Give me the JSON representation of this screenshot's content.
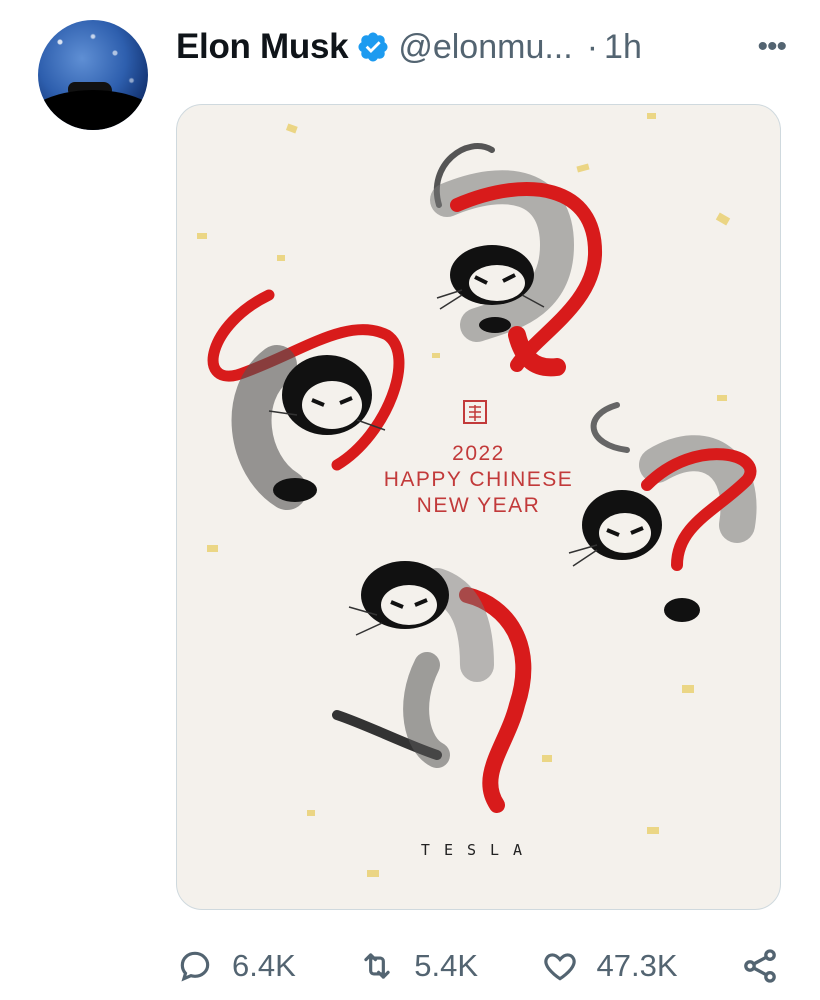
{
  "tweet": {
    "author_name": "Elon Musk",
    "handle": "@elonmu...",
    "separator": "·",
    "time": "1h",
    "more_label": "•••"
  },
  "image": {
    "greeting_year": "2022",
    "greeting_line1": "HAPPY CHINESE",
    "greeting_line2": "NEW YEAR",
    "brand": "TESLA",
    "accent_color": "#c23a3a"
  },
  "actions": {
    "reply_count": "6.4K",
    "retweet_count": "5.4K",
    "like_count": "47.3K"
  },
  "colors": {
    "verified": "#1d9bf0",
    "muted": "#536471",
    "text": "#0f1419"
  }
}
